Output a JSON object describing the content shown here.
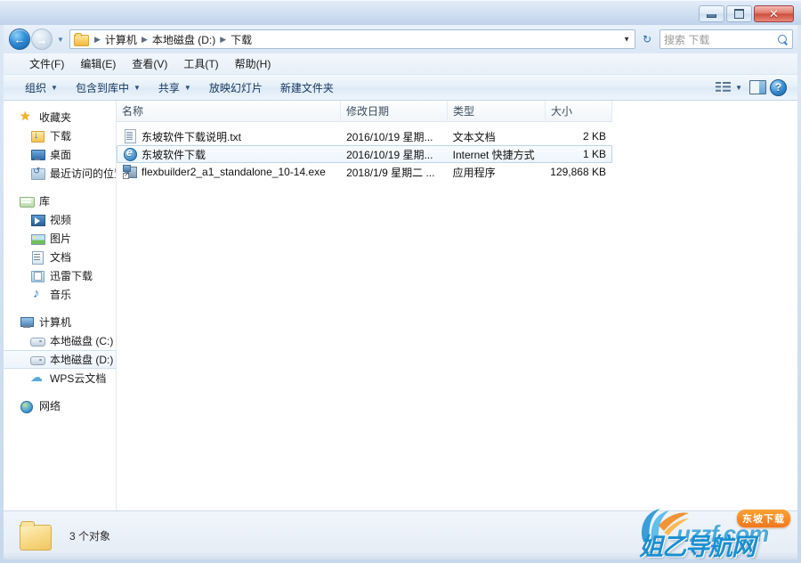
{
  "window": {
    "title": "",
    "controls": {
      "minimize": "minimize-button",
      "maximize": "maximize-button",
      "close_label": "✕"
    }
  },
  "address_bar": {
    "back_label": "←",
    "forward_label": "→",
    "history_caret": "▼",
    "folder_icon": "folder-icon",
    "breadcrumb": [
      {
        "label": "计算机"
      },
      {
        "label": "本地磁盘 (D:)"
      },
      {
        "label": "下载"
      }
    ],
    "separator": "▶",
    "dropdown_caret": "▼",
    "refresh_label": "↻",
    "search": {
      "placeholder": "搜索 下载",
      "value": ""
    }
  },
  "menubar": {
    "items": [
      {
        "label": "文件(F)"
      },
      {
        "label": "编辑(E)"
      },
      {
        "label": "查看(V)"
      },
      {
        "label": "工具(T)"
      },
      {
        "label": "帮助(H)"
      }
    ]
  },
  "toolbar": {
    "items": [
      {
        "label": "组织",
        "caret": "▼"
      },
      {
        "label": "包含到库中",
        "caret": "▼"
      },
      {
        "label": "共享",
        "caret": "▼"
      },
      {
        "label": "放映幻灯片",
        "caret": ""
      },
      {
        "label": "新建文件夹",
        "caret": ""
      }
    ],
    "view_caret": "▼",
    "help_label": "?"
  },
  "navpane": {
    "groups": [
      {
        "header": {
          "label": "收藏夹",
          "icon": "star-icon"
        },
        "items": [
          {
            "label": "下载",
            "icon": "download-folder-icon",
            "selected": false
          },
          {
            "label": "桌面",
            "icon": "desktop-icon",
            "selected": false
          },
          {
            "label": "最近访问的位置",
            "icon": "recent-places-icon",
            "selected": false
          }
        ]
      },
      {
        "header": {
          "label": "库",
          "icon": "library-icon"
        },
        "items": [
          {
            "label": "视频",
            "icon": "video-icon",
            "selected": false
          },
          {
            "label": "图片",
            "icon": "pictures-icon",
            "selected": false
          },
          {
            "label": "文档",
            "icon": "documents-icon",
            "selected": false
          },
          {
            "label": "迅雷下载",
            "icon": "thunder-download-icon",
            "selected": false
          },
          {
            "label": "音乐",
            "icon": "music-icon",
            "selected": false
          }
        ]
      },
      {
        "header": {
          "label": "计算机",
          "icon": "computer-icon"
        },
        "items": [
          {
            "label": "本地磁盘 (C:)",
            "icon": "disk-icon",
            "selected": false
          },
          {
            "label": "本地磁盘 (D:)",
            "icon": "disk-icon",
            "selected": true
          },
          {
            "label": "WPS云文档",
            "icon": "cloud-icon",
            "selected": false
          }
        ]
      },
      {
        "header": {
          "label": "网络",
          "icon": "network-icon"
        },
        "items": []
      }
    ]
  },
  "filelist": {
    "columns": [
      {
        "label": "名称"
      },
      {
        "label": "修改日期"
      },
      {
        "label": "类型"
      },
      {
        "label": "大小"
      }
    ],
    "rows": [
      {
        "name": "东坡软件下载说明.txt",
        "date": "2016/10/19 星期...",
        "type": "文本文档",
        "size": "2 KB",
        "icon": "text-file-icon",
        "selected": false
      },
      {
        "name": "东坡软件下载",
        "date": "2016/10/19 星期...",
        "type": "Internet 快捷方式",
        "size": "1 KB",
        "icon": "internet-shortcut-icon",
        "selected": true
      },
      {
        "name": "flexbuilder2_a1_standalone_10-14.exe",
        "date": "2018/1/9 星期二 ...",
        "type": "应用程序",
        "size": "129,868 KB",
        "icon": "application-icon",
        "selected": false
      }
    ]
  },
  "statusbar": {
    "folder_icon": "folder-icon",
    "text": "3 个对象"
  },
  "watermark": {
    "badge": "东坡下载",
    "domain": "uzzf.com",
    "site_name": "姐乙导航网"
  },
  "colors": {
    "accent": "#2f8fd8",
    "selection": "#b8d4ec",
    "titlebar": "#cfdff1",
    "close_button": "#cf4d3c",
    "watermark_orange": "#f2761c",
    "watermark_blue": "#1a8fd1"
  }
}
